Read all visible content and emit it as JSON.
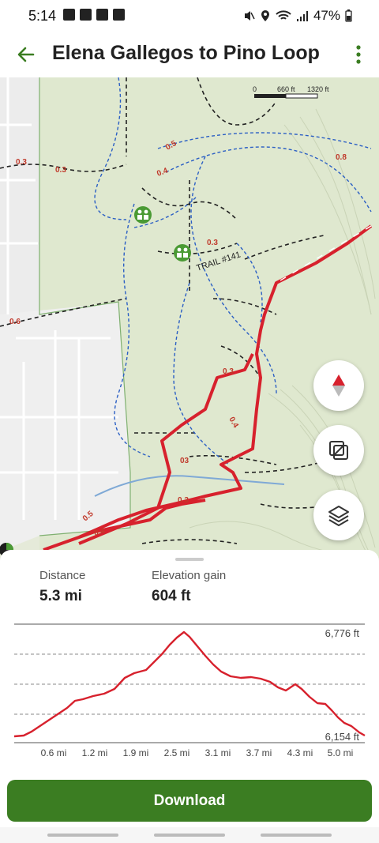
{
  "status": {
    "time": "5:14",
    "battery": "47%"
  },
  "header": {
    "title": "Elena Gallegos to Pino Loop"
  },
  "map": {
    "scale_labels": [
      "0",
      "660 ft",
      "1320 ft"
    ],
    "trail_label": "TRAIL #141",
    "segment_labels": [
      "0.3",
      "0.3",
      "0.5",
      "0.4",
      "0.8",
      "0.3",
      "0.6",
      "0.3",
      "0.4",
      "03",
      "0.3",
      "0.5",
      "0.4"
    ],
    "route_color": "#d7212d",
    "trail_color_blue": "#2b5fc4"
  },
  "stats": {
    "distance_label": "Distance",
    "distance_value": "5.3 mi",
    "elevation_label": "Elevation gain",
    "elevation_value": "604 ft"
  },
  "elevation_chart": {
    "max_label": "6,776 ft",
    "min_label": "6,154 ft",
    "x_ticks": [
      "0.6 mi",
      "1.2 mi",
      "1.9 mi",
      "2.5 mi",
      "3.1 mi",
      "3.7 mi",
      "4.3 mi",
      "5.0 mi"
    ]
  },
  "actions": {
    "download_label": "Download"
  }
}
